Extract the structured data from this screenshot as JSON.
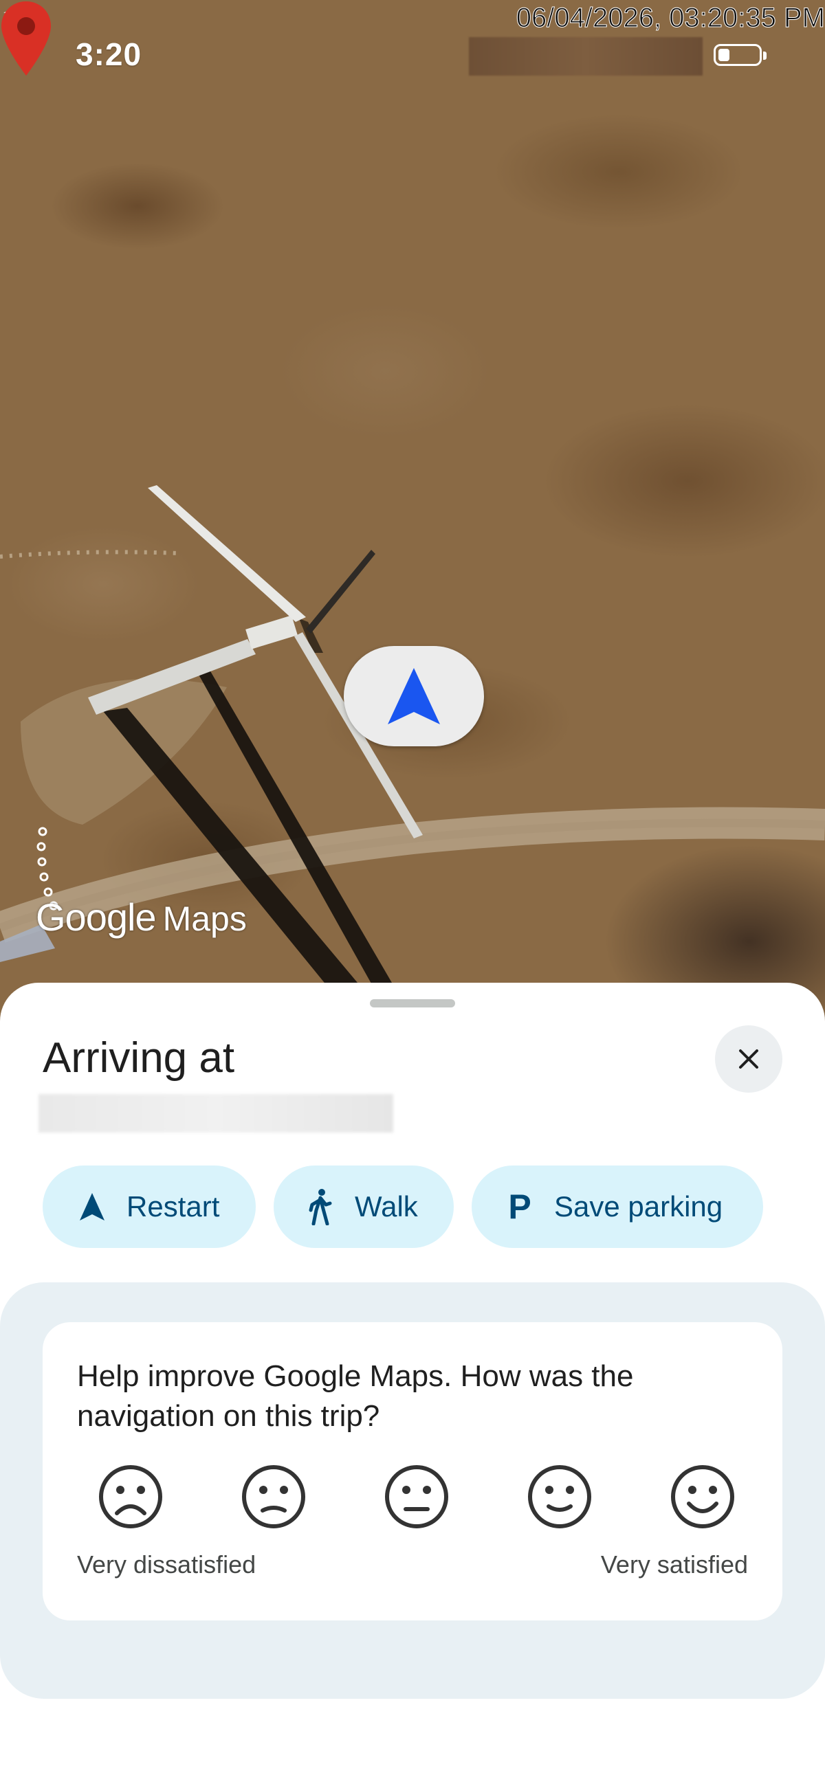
{
  "status_bar": {
    "time": "3:20",
    "timestamp_overlay": "06/04/2026, 03:20:35 PM"
  },
  "map": {
    "logo_google": "Google",
    "logo_maps": "Maps"
  },
  "sheet": {
    "title": "Arriving at",
    "actions": {
      "restart_label": "Restart",
      "walk_label": "Walk",
      "save_parking_label": "Save parking",
      "parking_glyph": "P"
    },
    "feedback": {
      "question": "Help improve Google Maps. How was the navigation on this trip?",
      "scale_low_label": "Very dissatisfied",
      "scale_high_label": "Very satisfied",
      "options": [
        "very-dissatisfied",
        "dissatisfied",
        "neutral",
        "satisfied",
        "very-satisfied"
      ]
    }
  },
  "colors": {
    "chip_bg": "#d9f3fb",
    "chip_text": "#004a77",
    "nav_arrow": "#1a56f0",
    "pin": "#d93025"
  }
}
